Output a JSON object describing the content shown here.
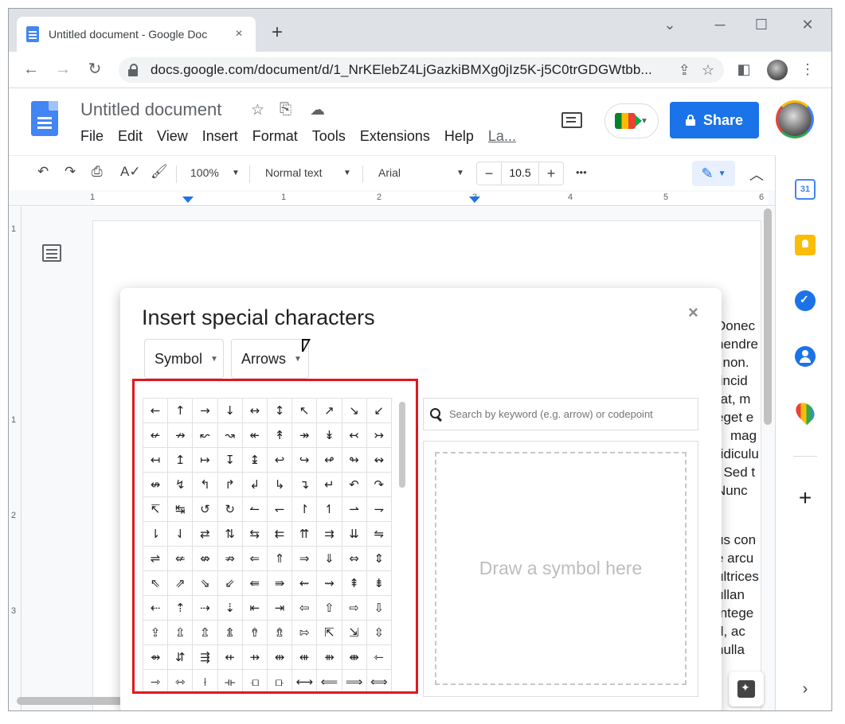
{
  "browser": {
    "tab_title": "Untitled document - Google Doc",
    "tab_close": "×",
    "new_tab": "+",
    "window_controls": {
      "minimize": "─",
      "maximize": "☐",
      "close": "✕",
      "tab_search": "⌄"
    },
    "nav": {
      "back": "←",
      "forward": "→",
      "reload": "↻"
    },
    "url": "docs.google.com/document/d/1_NrKElebZ4LjGazkiBMXg0jIz5K-j5C0trGDGWtbb...",
    "icons": [
      "share-icon",
      "star-icon",
      "side-panel-icon",
      "profile-avatar",
      "kebab-menu-icon"
    ]
  },
  "docs": {
    "title": "Untitled document",
    "menu": [
      "File",
      "Edit",
      "View",
      "Insert",
      "Format",
      "Tools",
      "Extensions",
      "Help",
      "La..."
    ],
    "share_label": "Share",
    "brand_colors": {
      "primary": "#1a73e8",
      "highlight": "#e3161e"
    }
  },
  "toolbar": {
    "zoom": "100%",
    "style": "Normal text",
    "font": "Arial",
    "font_size": "10.5",
    "minus": "−",
    "plus": "+",
    "more": "•••"
  },
  "ruler": {
    "h_numbers": [
      "1",
      "1",
      "2",
      "3",
      "4",
      "5",
      "6"
    ],
    "v_numbers": [
      "1",
      "1",
      "2",
      "3"
    ]
  },
  "document_text": [
    "Donec",
    "hendre",
    "l non.",
    "tincid",
    "rat, m",
    "eget e",
    "mag",
    "ridiculu",
    ". Sed t",
    "Nunc",
    "us con",
    "e arcu",
    "ultrices",
    "ullan",
    "Intege",
    "d, ac",
    "nulla"
  ],
  "dialog": {
    "title": "Insert special characters",
    "close": "×",
    "category": "Symbol",
    "subcategory": "Arrows",
    "search_placeholder": "Search by keyword (e.g. arrow) or codepoint",
    "draw_label": "Draw a symbol here",
    "symbols": [
      [
        "←",
        "↑",
        "→",
        "↓",
        "↔",
        "↕",
        "↖",
        "↗",
        "↘",
        "↙"
      ],
      [
        "↚",
        "↛",
        "↜",
        "↝",
        "↞",
        "↟",
        "↠",
        "↡",
        "↢",
        "↣"
      ],
      [
        "↤",
        "↥",
        "↦",
        "↧",
        "↨",
        "↩",
        "↪",
        "↫",
        "↬",
        "↭"
      ],
      [
        "↮",
        "↯",
        "↰",
        "↱",
        "↲",
        "↳",
        "↴",
        "↵",
        "↶",
        "↷"
      ],
      [
        "↸",
        "↹",
        "↺",
        "↻",
        "↼",
        "↽",
        "↾",
        "↿",
        "⇀",
        "⇁"
      ],
      [
        "⇂",
        "⇃",
        "⇄",
        "⇅",
        "⇆",
        "⇇",
        "⇈",
        "⇉",
        "⇊",
        "⇋"
      ],
      [
        "⇌",
        "⇍",
        "⇎",
        "⇏",
        "⇐",
        "⇑",
        "⇒",
        "⇓",
        "⇔",
        "⇕"
      ],
      [
        "⇖",
        "⇗",
        "⇘",
        "⇙",
        "⇚",
        "⇛",
        "⇜",
        "⇝",
        "⇞",
        "⇟"
      ],
      [
        "⇠",
        "⇡",
        "⇢",
        "⇣",
        "⇤",
        "⇥",
        "⇦",
        "⇧",
        "⇨",
        "⇩"
      ],
      [
        "⇪",
        "⇫",
        "⇬",
        "⇭",
        "⇮",
        "⇯",
        "⇰",
        "⇱",
        "⇲",
        "⇳"
      ],
      [
        "⇴",
        "⇵",
        "⇶",
        "⇷",
        "⇸",
        "⇹",
        "⇺",
        "⇻",
        "⇼",
        "⇽"
      ],
      [
        "⇾",
        "⇿",
        "⟊",
        "⟛",
        "⟤",
        "⟥",
        "⟷",
        "⟸",
        "⟹",
        "⟺"
      ]
    ]
  },
  "side_panel": {
    "calendar_day": "31",
    "apps": [
      "calendar-icon",
      "keep-icon",
      "tasks-icon",
      "contacts-icon",
      "maps-icon"
    ],
    "add": "+",
    "expand": "›"
  }
}
